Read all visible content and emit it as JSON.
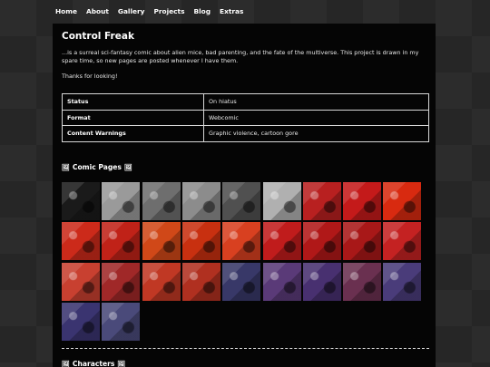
{
  "nav": {
    "items": [
      {
        "label": "Home",
        "name": "nav-home"
      },
      {
        "label": "About",
        "name": "nav-about"
      },
      {
        "label": "Gallery",
        "name": "nav-gallery"
      },
      {
        "label": "Projects",
        "name": "nav-projects"
      },
      {
        "label": "Blog",
        "name": "nav-blog"
      },
      {
        "label": "Extras",
        "name": "nav-extras"
      }
    ]
  },
  "page": {
    "title": "Control Freak",
    "description": "...is a surreal sci-fantasy comic about alien mice, bad parenting, and the fate of the multiverse. This project is drawn in my spare time, so new pages are posted whenever I have them.",
    "thanks": "Thanks for looking!"
  },
  "info_table": [
    {
      "key": "Status",
      "value": "On hiatus"
    },
    {
      "key": "Format",
      "value": "Webcomic"
    },
    {
      "key": "Content Warnings",
      "value": "Graphic violence, cartoon gore"
    }
  ],
  "sections": {
    "comic_pages": "Comic Pages",
    "characters": "Characters",
    "icon": "image-icon"
  },
  "thumbnails": [
    "#1a1a1a",
    "#9a9a9a",
    "#6e6e6e",
    "#8c8c8c",
    "#505050",
    "#b0b0b0",
    "#b82020",
    "#c41a1a",
    "#d82a10",
    "#cc2a1a",
    "#c02218",
    "#d04818",
    "#c83010",
    "#d84020",
    "#c01c1c",
    "#b01818",
    "#a81818",
    "#c42222",
    "#c84030",
    "#a02828",
    "#c03824",
    "#b03020",
    "#383868",
    "#5a3a78",
    "#483070",
    "#6a3050",
    "#4a3c7a",
    "#3a3470",
    "#4a4a7a"
  ],
  "colors": {
    "panel": "#050505",
    "accent_red": "#c41a1a",
    "text": "#e6e6e6"
  }
}
